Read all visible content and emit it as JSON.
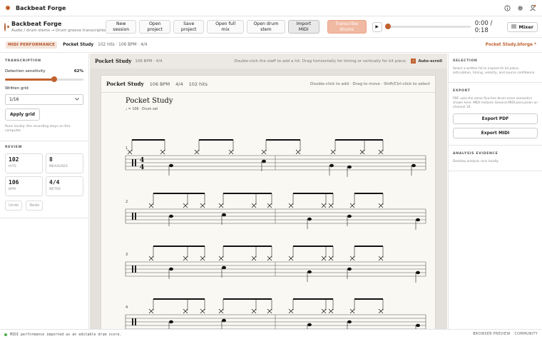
{
  "app": {
    "title": "Backbeat Forge"
  },
  "brand": {
    "name": "Backbeat Forge",
    "subtitle": "Audio / drum stems → Drum groove transcription"
  },
  "toolbar": {
    "new_session": "New session",
    "open_project": "Open project",
    "save_project": "Save project",
    "open_full_mix": "Open full mix",
    "open_drum_stem": "Open drum stem",
    "import_midi": "Import MIDI",
    "transcribe_drums": "Transcribe drums",
    "play_symbol": "▶",
    "time": "0:00 / 0:18",
    "mixer_label": "Mixer"
  },
  "subbar": {
    "badge": "MIDI PERFORMANCE",
    "score_name": "Pocket Study",
    "meta": "102 hits · 106 BPM · 4/4",
    "file_name": "Pocket Study.bforge *"
  },
  "transcription": {
    "heading": "TRANSCRIPTION",
    "sensitivity_label": "Detection sensitivity",
    "sensitivity_value": "62%",
    "sensitivity_fraction": 0.62,
    "grid_label": "Written grid",
    "grid_value": "1/16",
    "apply_label": "Apply grid",
    "hint": "Runs locally; the recording stays on this computer."
  },
  "review": {
    "heading": "REVIEW",
    "stats": [
      {
        "value": "102",
        "key": "HITS"
      },
      {
        "value": "8",
        "key": "MEASURES"
      },
      {
        "value": "106",
        "key": "BPM"
      },
      {
        "value": "4/4",
        "key": "METER"
      }
    ],
    "undo": "Undo",
    "redo": "Redo"
  },
  "canvas": {
    "title": "Pocket Study",
    "meta": "106 BPM · 4/4",
    "hint": "Double-click the staff to add a hit. Drag horizontally for timing or vertically for kit piece.",
    "autoscroll": "Auto-scroll"
  },
  "paper": {
    "title": "Pocket Study",
    "bpm": "106 BPM",
    "meter": "4/4",
    "hits": "102 hits",
    "hint": "Double-click to add · Drag to move · Shift/Ctrl-click to select",
    "score_title": "Pocket Study",
    "score_sub": "♩ = 106 · Drum set",
    "time_signature": [
      "4",
      "4"
    ],
    "systems": [
      "1",
      "2",
      "3",
      "4"
    ]
  },
  "selection": {
    "heading": "SELECTION",
    "hint": "Select a written hit to inspect its kit piece, articulation, timing, velocity, and source confidence."
  },
  "export": {
    "heading": "EXPORT",
    "hint": "PDF uses the same five-line drum-score semantics shown here. MIDI restores General MIDI percussion on channel 10.",
    "pdf": "Export PDF",
    "midi": "Export MIDI"
  },
  "evidence": {
    "heading": "ANALYSIS EVIDENCE",
    "hint": "Desktop analysis runs locally."
  },
  "status": {
    "message": "MIDI performance imported as an editable drum score.",
    "right1": "BROWSER PREVIEW",
    "right2": "COMMUNITY"
  },
  "colors": {
    "accent": "#c0622f",
    "accent_light": "#f0b9a2",
    "paper": "#faf8f3"
  }
}
